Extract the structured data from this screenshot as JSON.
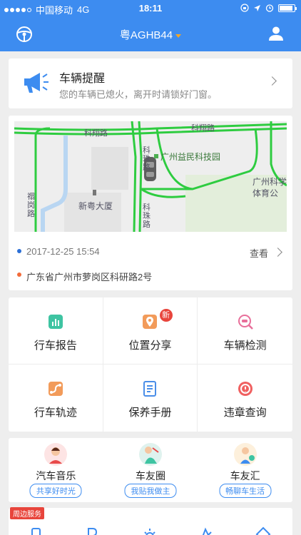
{
  "status_bar": {
    "carrier": "中国移动",
    "network": "4G",
    "time": "18:11"
  },
  "header": {
    "plate": "粤AGHB44",
    "left_icon": "steering-wheel-icon",
    "right_icon": "user-icon"
  },
  "reminder": {
    "title": "车辆提醒",
    "message": "您的车辆已熄火，离开时请锁好门窗。"
  },
  "location": {
    "timestamp": "2017-12-25 15:54",
    "view_label": "查看",
    "address": "广东省广州市萝岗区科研路2号",
    "map_labels": {
      "road_top": "科翔路",
      "road_top_right": "科翔路",
      "road_mid": "科珠路",
      "road_mid2": "科珠路",
      "road_left": "禤岗路",
      "park": "广州益民科技园",
      "building": "新粤大厦",
      "stadium_line1": "广州科学",
      "stadium_line2": "体育公"
    }
  },
  "features": [
    {
      "label": "行车报告",
      "icon": "driving-report-icon",
      "color": "#3ec4a2"
    },
    {
      "label": "位置分享",
      "icon": "location-share-icon",
      "color": "#f29b5a",
      "badge": "新"
    },
    {
      "label": "车辆检测",
      "icon": "vehicle-check-icon",
      "color": "#e86f9a"
    },
    {
      "label": "行车轨迹",
      "icon": "track-icon",
      "color": "#f29b5a"
    },
    {
      "label": "保养手册",
      "icon": "maintenance-manual-icon",
      "color": "#4a8ee8"
    },
    {
      "label": "违章查询",
      "icon": "violation-query-icon",
      "color": "#f06060"
    }
  ],
  "social": [
    {
      "name": "汽车音乐",
      "tag": "共享好时光"
    },
    {
      "name": "车友圈",
      "tag": "我贴我做主"
    },
    {
      "name": "车友汇",
      "tag": "畅聊车生活"
    }
  ],
  "services": {
    "tag": "周边服务"
  },
  "colors": {
    "primary": "#3d8cf0",
    "road": "#2ecc40",
    "badge": "#e8453c",
    "timestamp_dot": "#2b6fd6",
    "address_dot": "#f26b3a"
  }
}
